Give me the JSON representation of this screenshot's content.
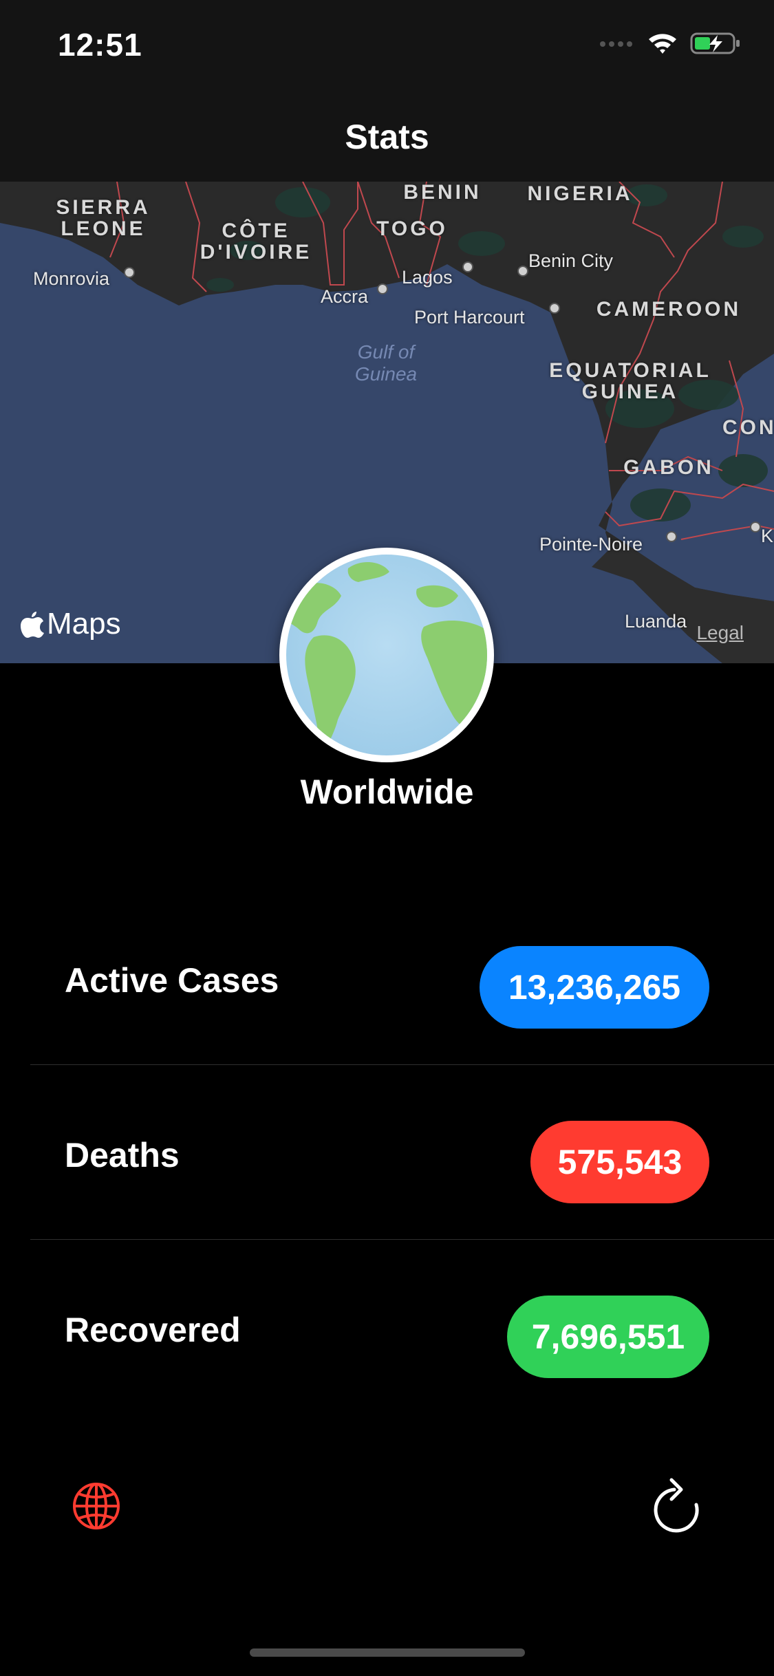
{
  "status_bar": {
    "time": "12:51"
  },
  "nav": {
    "title": "Stats"
  },
  "map": {
    "countries": [
      {
        "id": "sierra-leone",
        "label": "SIERRA\nLEONE"
      },
      {
        "id": "cote-divoire",
        "label": "CÔTE\nD'IVOIRE"
      },
      {
        "id": "benin",
        "label": "BENIN"
      },
      {
        "id": "nigeria",
        "label": "NIGERIA"
      },
      {
        "id": "togo",
        "label": "TOGO"
      },
      {
        "id": "cameroon",
        "label": "CAMEROON"
      },
      {
        "id": "equatorial-guinea",
        "label": "EQUATORIAL\nGUINEA"
      },
      {
        "id": "gabon",
        "label": "GABON"
      },
      {
        "id": "congo",
        "label": "CON"
      }
    ],
    "cities": [
      "Monrovia",
      "Accra",
      "Lagos",
      "Benin City",
      "Port Harcourt",
      "Pointe-Noire",
      "Luanda",
      "K"
    ],
    "water": "Gulf of\nGuinea",
    "maps_label": "Maps",
    "legal_label": "Legal"
  },
  "location": {
    "name": "Worldwide"
  },
  "stats": [
    {
      "label": "Active Cases",
      "value": "13,236,265",
      "color": "#0a84ff"
    },
    {
      "label": "Deaths",
      "value": "575,543",
      "color": "#ff3b30"
    },
    {
      "label": "Recovered",
      "value": "7,696,551",
      "color": "#30d158"
    }
  ],
  "toolbar": {
    "globe_icon": "globe-icon",
    "refresh_icon": "refresh-icon",
    "accent": "#ff3b30"
  }
}
